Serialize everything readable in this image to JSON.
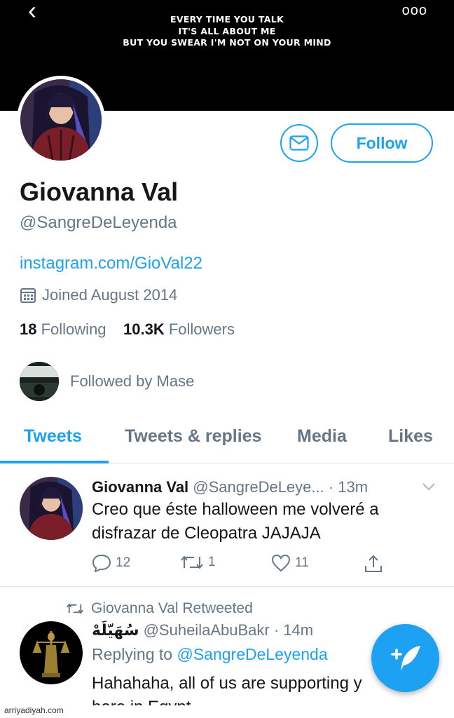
{
  "nav": {
    "back_glyph": "‹",
    "more_glyph": "ooo"
  },
  "banner": {
    "line1": "EVERY TIME YOU TALK",
    "line2": "IT'S ALL ABOUT ME",
    "line3": "BUT YOU SWEAR I'M NOT ON YOUR MIND"
  },
  "profile": {
    "name": "Giovanna Val",
    "handle": "@SangreDeLeyenda",
    "link": "instagram.com/GioVal22",
    "joined": "Joined August 2014",
    "following_count": "18",
    "following_label": "Following",
    "followers_count": "10.3K",
    "followers_label": "Followers",
    "followed_by": "Followed by Mase",
    "follow_button": "Follow"
  },
  "tabs": [
    "Tweets",
    "Tweets & replies",
    "Media",
    "Likes"
  ],
  "tweets": [
    {
      "name": "Giovanna Val",
      "handle": "@SangreDeLeye...",
      "time": "· 13m",
      "text_line1": "Creo que éste halloween me volveré a",
      "text_line2": "disfrazar de Cleopatra JAJAJA",
      "replies": "12",
      "retweets": "1",
      "likes": "11"
    },
    {
      "retweet_note": "Giovanna Val Retweeted",
      "name": "سُهَيّلَهْ",
      "handle": "@SuheilaAbuBakr",
      "time": "· 14m",
      "replying_prefix": "Replying to",
      "replying_to": "@SangreDeLeyenda",
      "text_line1": "Hahahaha, all of us are supporting y",
      "text_line2": "here in Egypt"
    }
  ],
  "watermark": "arriyadiyah.com",
  "colors": {
    "accent": "#1da1f2",
    "muted": "#657786",
    "text": "#14171a"
  }
}
